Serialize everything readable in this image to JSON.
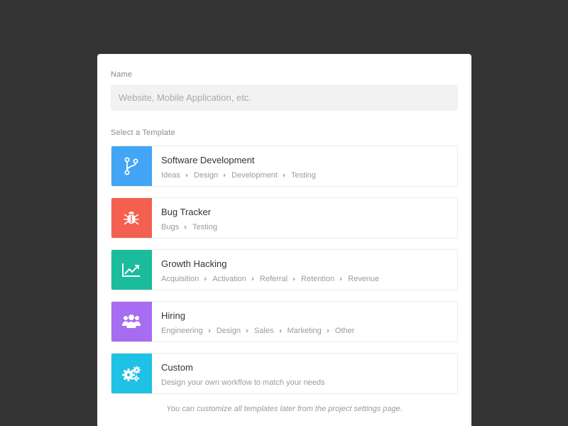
{
  "form": {
    "name_label": "Name",
    "name_placeholder": "Website, Mobile Application, etc.",
    "name_value": "",
    "template_label": "Select a Template",
    "footnote": "You can customize all templates later from the project settings page."
  },
  "templates": [
    {
      "title": "Software Development",
      "icon": "branch-icon",
      "color": "#42a5f5",
      "steps": [
        "Ideas",
        "Design",
        "Development",
        "Testing"
      ]
    },
    {
      "title": "Bug Tracker",
      "icon": "bug-icon",
      "color": "#f4604f",
      "steps": [
        "Bugs",
        "Testing"
      ]
    },
    {
      "title": "Growth Hacking",
      "icon": "trend-chart-icon",
      "color": "#1abc9c",
      "steps": [
        "Acquisition",
        "Activation",
        "Referral",
        "Retention",
        "Revenue"
      ]
    },
    {
      "title": "Hiring",
      "icon": "people-icon",
      "color": "#a66cf2",
      "steps": [
        "Engineering",
        "Design",
        "Sales",
        "Marketing",
        "Other"
      ]
    },
    {
      "title": "Custom",
      "icon": "gears-icon",
      "color": "#1fc1e4",
      "description": "Design your own workflow to match your needs"
    }
  ]
}
